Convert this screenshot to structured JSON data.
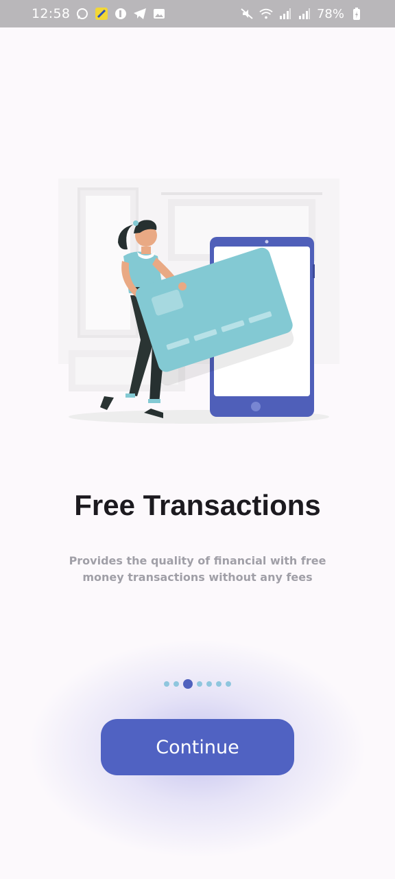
{
  "status_bar": {
    "time": "12:58",
    "battery": "78%",
    "left_icons": [
      "whatsapp-icon",
      "app-icon",
      "app-icon",
      "telegram-icon",
      "gallery-icon"
    ],
    "right_icons": [
      "mute-icon",
      "wifi-icon",
      "signal-icon",
      "signal-icon",
      "battery-charging-icon"
    ]
  },
  "onboarding": {
    "illustration": "woman-holding-credit-card-with-phone-illustration",
    "title": "Free Transactions",
    "subtitle": "Provides the quality of financial with free money transactions without any fees",
    "page_count": 7,
    "active_page": 2,
    "continue_label": "Continue"
  },
  "colors": {
    "accent": "#5062c2",
    "dot_inactive": "#8fc6de",
    "card": "#83c9d3"
  }
}
